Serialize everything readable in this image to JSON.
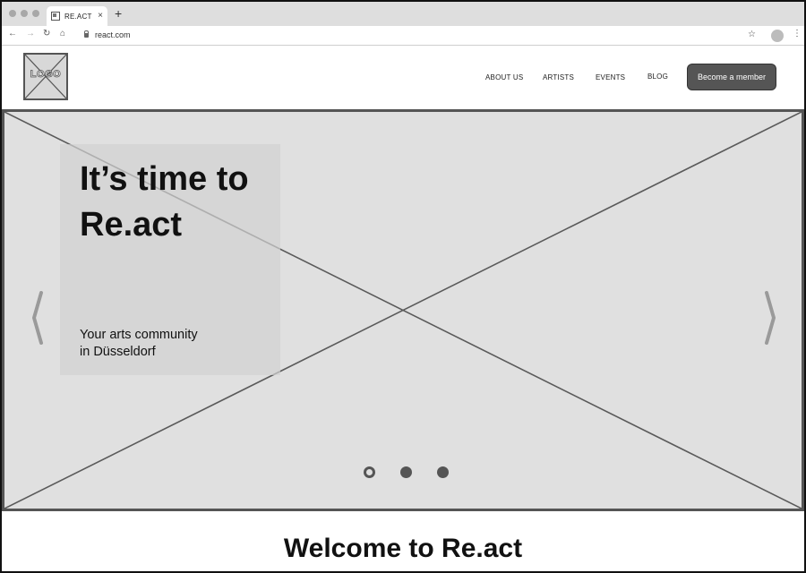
{
  "browser": {
    "tab_title": "RE.ACT",
    "tab_close": "×",
    "new_tab": "+",
    "back": "←",
    "forward": "→",
    "reload": "↻",
    "home": "⌂",
    "url": "react.com",
    "bookmark": "☆",
    "menu": "⋮"
  },
  "header": {
    "logo_text": "LOGO",
    "nav": [
      "ABOUT US",
      "ARTISTS",
      "EVENTS",
      "BLOG"
    ],
    "cta_label": "Become a member"
  },
  "hero": {
    "title": "It’s time to Re.act",
    "subtitle_line1": "Your arts community",
    "subtitle_line2": "in Düsseldorf",
    "slide_count": 3,
    "active_slide": 1
  },
  "welcome": {
    "heading": "Welcome to Re.act"
  },
  "colors": {
    "accent": "#555555",
    "hero_bg": "#e0e0e0",
    "chrome_bg": "#dedede"
  },
  "icons": [
    "close-icon",
    "plus-icon",
    "back-arrow-icon",
    "forward-arrow-icon",
    "reload-icon",
    "home-icon",
    "lock-icon",
    "star-icon",
    "profile-icon",
    "kebab-menu-icon",
    "chevron-left-icon",
    "chevron-right-icon"
  ]
}
